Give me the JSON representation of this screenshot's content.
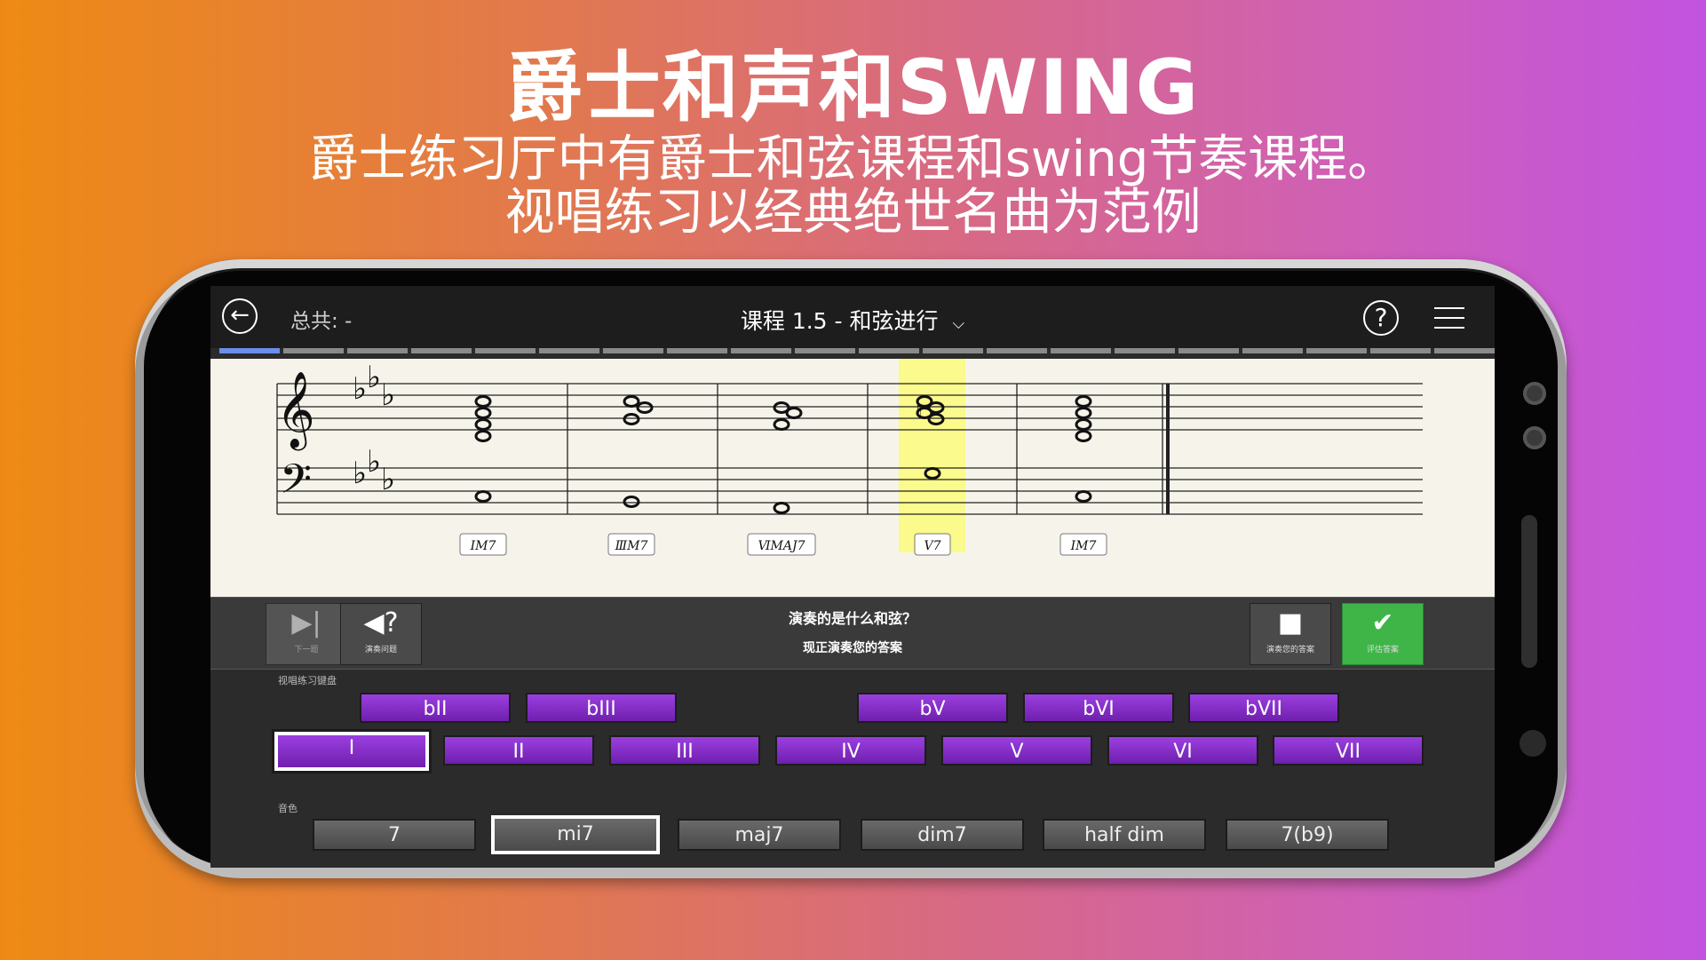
{
  "promo": {
    "title": "爵士和声和SWING",
    "line1": "爵士练习厅中有爵士和弦课程和swing节奏课程。",
    "line2": "视唱练习以经典绝世名曲为范例"
  },
  "topbar": {
    "total_label": "总共: -",
    "course_title": "课程 1.5 - 和弦进行",
    "chevron": "⌵",
    "help_glyph": "?"
  },
  "progress": {
    "total_segments": 20,
    "done_segments": 1
  },
  "score": {
    "chord_labels": [
      "ⅠM7",
      "ⅢM7",
      "ⅥMAJ7",
      "V7",
      "ⅠM7"
    ],
    "highlight_index": 4
  },
  "controls": {
    "next_caption": "下一题",
    "play_caption": "演奏问题",
    "prompt_question": "演奏的是什么和弦？",
    "prompt_instruction": "现正演奏您的答案",
    "stop_caption": "演奏您的答案",
    "check_caption": "评估答案"
  },
  "keyboard": {
    "section_label": "视唱练习键盘",
    "altered": [
      "bII",
      "bIII",
      "bV",
      "bVI",
      "bVII"
    ],
    "degrees": [
      "I",
      "II",
      "III",
      "IV",
      "V",
      "VI",
      "VII"
    ],
    "selected_degree": "I"
  },
  "quality": {
    "section_label": "音色",
    "options": [
      "7",
      "mi7",
      "maj7",
      "dim7",
      "half dim",
      "7(b9)"
    ],
    "selected": "mi7"
  },
  "colors": {
    "accent_purple": "#8a32d0",
    "check_green": "#3fb548",
    "progress_blue": "#6b8fe8",
    "highlight_yellow": "#fbfa8c"
  }
}
